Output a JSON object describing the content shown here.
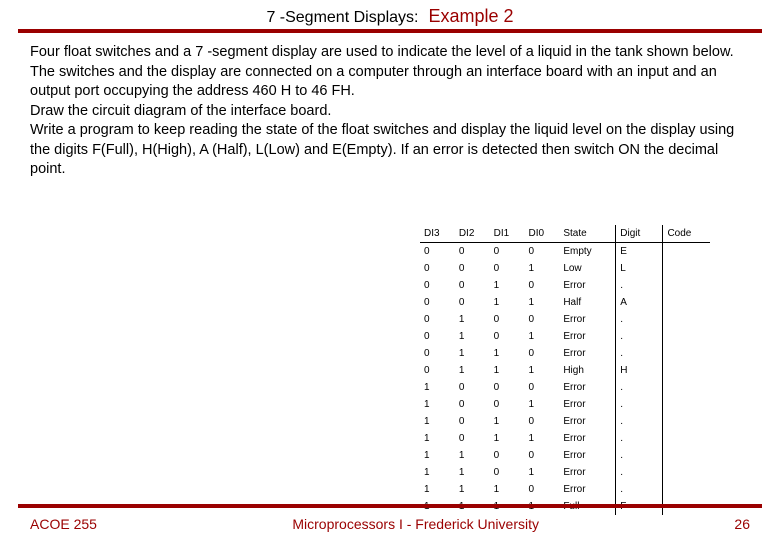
{
  "header": {
    "title": "7 -Segment Displays:",
    "subtitle": "Example 2"
  },
  "paragraphs": {
    "p1": "Four float switches and a 7 -segment display are used to indicate the level of a liquid in the tank shown below. The switches and the display are connected on a computer through an interface board with an input and an output port occupying the address 460 H to 46 FH.",
    "p2": "Draw the circuit diagram of the interface board.",
    "p3": "Write a program to keep reading the state of the float switches and display the  liquid level on the display using the digits F(Full), H(High), A (Half), L(Low) and E(Empty). If an error is detected then switch ON the decimal point."
  },
  "table": {
    "headers": {
      "h1": "DI3",
      "h2": "DI2",
      "h3": "DI1",
      "h4": "DI0",
      "h5": "State",
      "h6": "Digit",
      "h7": "Code"
    },
    "rows": [
      {
        "d3": "0",
        "d2": "0",
        "d1": "0",
        "d0": "0",
        "state": "Empty",
        "digit": "E",
        "code": ""
      },
      {
        "d3": "0",
        "d2": "0",
        "d1": "0",
        "d0": "1",
        "state": "Low",
        "digit": "L",
        "code": ""
      },
      {
        "d3": "0",
        "d2": "0",
        "d1": "1",
        "d0": "0",
        "state": "Error",
        "digit": ".",
        "code": ""
      },
      {
        "d3": "0",
        "d2": "0",
        "d1": "1",
        "d0": "1",
        "state": "Half",
        "digit": "A",
        "code": ""
      },
      {
        "d3": "0",
        "d2": "1",
        "d1": "0",
        "d0": "0",
        "state": "Error",
        "digit": ".",
        "code": ""
      },
      {
        "d3": "0",
        "d2": "1",
        "d1": "0",
        "d0": "1",
        "state": "Error",
        "digit": ".",
        "code": ""
      },
      {
        "d3": "0",
        "d2": "1",
        "d1": "1",
        "d0": "0",
        "state": "Error",
        "digit": ".",
        "code": ""
      },
      {
        "d3": "0",
        "d2": "1",
        "d1": "1",
        "d0": "1",
        "state": "High",
        "digit": "H",
        "code": ""
      },
      {
        "d3": "1",
        "d2": "0",
        "d1": "0",
        "d0": "0",
        "state": "Error",
        "digit": ".",
        "code": ""
      },
      {
        "d3": "1",
        "d2": "0",
        "d1": "0",
        "d0": "1",
        "state": "Error",
        "digit": ".",
        "code": ""
      },
      {
        "d3": "1",
        "d2": "0",
        "d1": "1",
        "d0": "0",
        "state": "Error",
        "digit": ".",
        "code": ""
      },
      {
        "d3": "1",
        "d2": "0",
        "d1": "1",
        "d0": "1",
        "state": "Error",
        "digit": ".",
        "code": ""
      },
      {
        "d3": "1",
        "d2": "1",
        "d1": "0",
        "d0": "0",
        "state": "Error",
        "digit": ".",
        "code": ""
      },
      {
        "d3": "1",
        "d2": "1",
        "d1": "0",
        "d0": "1",
        "state": "Error",
        "digit": ".",
        "code": ""
      },
      {
        "d3": "1",
        "d2": "1",
        "d1": "1",
        "d0": "0",
        "state": "Error",
        "digit": ".",
        "code": ""
      },
      {
        "d3": "1",
        "d2": "1",
        "d1": "1",
        "d0": "1",
        "state": "Full",
        "digit": "F",
        "code": ""
      }
    ]
  },
  "footer": {
    "left": "ACOE 255",
    "center": "Microprocessors I - Frederick University",
    "right": "26"
  }
}
